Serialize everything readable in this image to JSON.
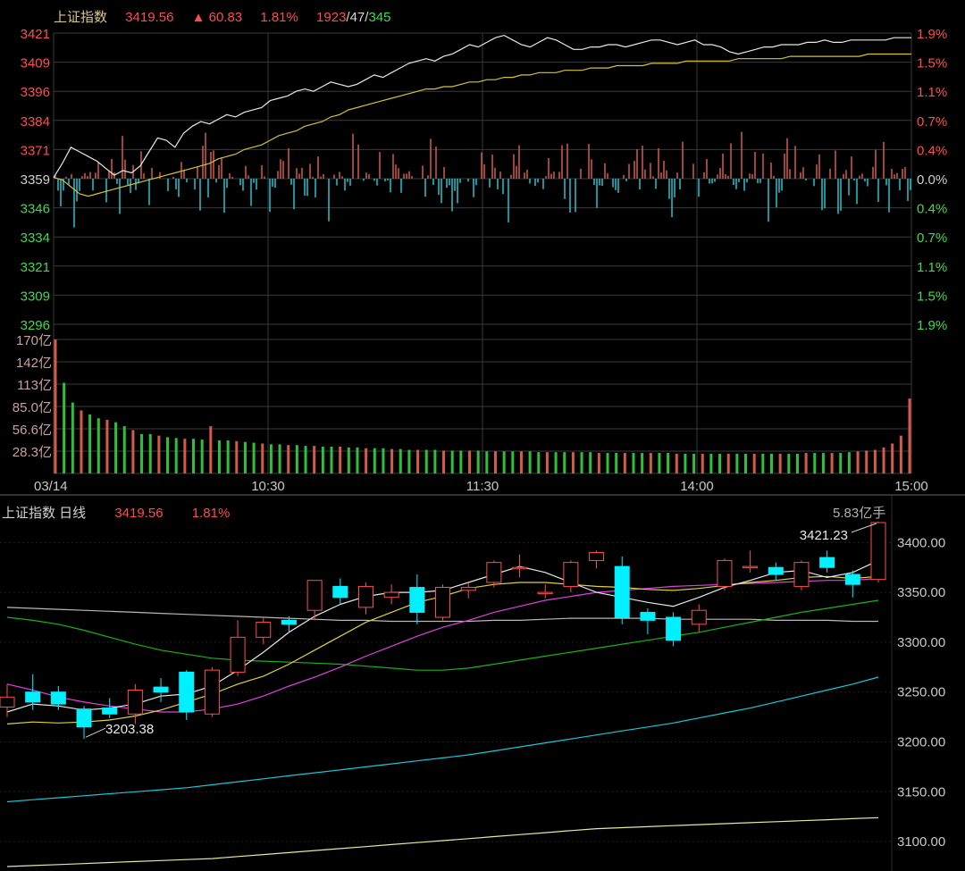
{
  "intraday": {
    "index_name": "上证指数",
    "price": "3419.56",
    "change": "▲ 60.83",
    "pct": "1.81%",
    "breadth_up": "1923",
    "breadth_flat": "47",
    "breadth_down": "345",
    "breadth_sep": "/"
  },
  "daily": {
    "title": "上证指数 日线",
    "price": "3419.56",
    "pct": "1.81%",
    "volume": "5.83亿手"
  },
  "colors": {
    "up": "#ff4d4d",
    "down": "#3ddc4a",
    "bar_down": "#25c4d0",
    "price_line": "#e8e8e8",
    "avg_line": "#d6c23a",
    "grid": "#3a3a3a",
    "candle_down_fill": "#00f0ff",
    "ma5": "#e8e8e8",
    "ma10": "#e0d23a",
    "ma20": "#e040e0",
    "ma30": "#19b219",
    "ma60": "#b8b8b8",
    "ma120": "#19c8d8",
    "ma250": "#e8e8a0"
  },
  "chart_data": [
    {
      "type": "line",
      "name": "intraday",
      "y_left_ticks": [
        "3421",
        "3409",
        "3396",
        "3384",
        "3371",
        "3359",
        "3346",
        "3334",
        "3321",
        "3309",
        "3296"
      ],
      "y_right_ticks": [
        "1.9%",
        "1.5%",
        "1.1%",
        "0.7%",
        "0.4%",
        "0.0%",
        "0.4%",
        "0.7%",
        "1.1%",
        "1.5%",
        "1.9%"
      ],
      "ylim": [
        3296,
        3421
      ],
      "prev_close": 3359,
      "price": [
        3359,
        3365,
        3372,
        3370,
        3368,
        3366,
        3363,
        3360,
        3362,
        3361,
        3364,
        3370,
        3376,
        3375,
        3372,
        3378,
        3381,
        3383,
        3382,
        3384,
        3386,
        3385,
        3387,
        3388,
        3389,
        3392,
        3393,
        3394,
        3396,
        3397,
        3396,
        3398,
        3400,
        3399,
        3398,
        3399,
        3401,
        3403,
        3402,
        3404,
        3406,
        3408,
        3409,
        3410,
        3409,
        3411,
        3412,
        3414,
        3416,
        3415,
        3417,
        3419,
        3420,
        3418,
        3416,
        3415,
        3417,
        3419,
        3418,
        3416,
        3414,
        3414,
        3415,
        3415,
        3416,
        3416,
        3415,
        3416,
        3417,
        3418,
        3418,
        3417,
        3416,
        3417,
        3418,
        3416,
        3416,
        3415,
        3413,
        3412,
        3413,
        3414,
        3415,
        3415,
        3416,
        3416,
        3416,
        3417,
        3417,
        3418,
        3417,
        3417,
        3418,
        3418,
        3418,
        3418,
        3418,
        3419,
        3419,
        3419
      ],
      "avg": [
        3359,
        3358,
        3355,
        3352,
        3351,
        3352,
        3353,
        3354,
        3355,
        3356,
        3357,
        3358,
        3359,
        3360,
        3361,
        3362,
        3363,
        3364,
        3365,
        3367,
        3368,
        3369,
        3371,
        3372,
        3373,
        3375,
        3377,
        3378,
        3379,
        3381,
        3382,
        3383,
        3385,
        3386,
        3388,
        3389,
        3390,
        3391,
        3392,
        3393,
        3394,
        3395,
        3396,
        3397,
        3397,
        3398,
        3398,
        3399,
        3400,
        3400,
        3401,
        3401,
        3402,
        3402,
        3403,
        3403,
        3404,
        3404,
        3404,
        3405,
        3405,
        3405,
        3406,
        3406,
        3406,
        3407,
        3407,
        3407,
        3407,
        3408,
        3408,
        3408,
        3408,
        3409,
        3409,
        3409,
        3409,
        3409,
        3409,
        3410,
        3410,
        3410,
        3410,
        3410,
        3410,
        3411,
        3411,
        3411,
        3411,
        3411,
        3411,
        3411,
        3411,
        3411,
        3412,
        3412,
        3412,
        3412,
        3412,
        3412
      ],
      "x_ticks": [
        "03/14",
        "10:30",
        "11:30",
        "14:00",
        "15:00"
      ]
    },
    {
      "type": "bar",
      "name": "intraday-volume",
      "y_ticks": [
        "170亿",
        "142亿",
        "113亿",
        "85.0亿",
        "56.6亿",
        "28.3亿"
      ],
      "ylim": [
        0,
        170
      ],
      "values": [
        170,
        115,
        90,
        80,
        75,
        70,
        68,
        65,
        60,
        55,
        50,
        50,
        48,
        46,
        45,
        44,
        44,
        43,
        60,
        42,
        42,
        41,
        40,
        39,
        38,
        37,
        37,
        36,
        36,
        35,
        35,
        34,
        34,
        34,
        33,
        33,
        32,
        32,
        32,
        31,
        31,
        30,
        30,
        30,
        30,
        29,
        29,
        29,
        29,
        29,
        28,
        28,
        28,
        28,
        28,
        28,
        27,
        27,
        27,
        27,
        27,
        27,
        27,
        26,
        26,
        26,
        26,
        26,
        26,
        26,
        26,
        26,
        25,
        25,
        25,
        25,
        25,
        25,
        25,
        25,
        25,
        25,
        25,
        25,
        25,
        25,
        25,
        26,
        26,
        26,
        26,
        26,
        27,
        28,
        29,
        30,
        33,
        38,
        48,
        95
      ]
    },
    {
      "type": "line",
      "name": "daily-candles",
      "y_ticks": [
        "3400.00",
        "3350.00",
        "3300.00",
        "3250.00",
        "3200.00",
        "3150.00",
        "3100.00"
      ],
      "ylim": [
        3075,
        3420
      ],
      "annotations": [
        "3421.23",
        "3203.38"
      ],
      "candles": [
        {
          "o": 3235,
          "c": 3245,
          "h": 3258,
          "l": 3225
        },
        {
          "o": 3250,
          "c": 3240,
          "h": 3268,
          "l": 3232
        },
        {
          "o": 3250,
          "c": 3238,
          "h": 3256,
          "l": 3232
        },
        {
          "o": 3233,
          "c": 3215,
          "h": 3236,
          "l": 3203
        },
        {
          "o": 3234,
          "c": 3228,
          "h": 3244,
          "l": 3224
        },
        {
          "o": 3228,
          "c": 3252,
          "h": 3258,
          "l": 3218
        },
        {
          "o": 3255,
          "c": 3250,
          "h": 3264,
          "l": 3240
        },
        {
          "o": 3270,
          "c": 3230,
          "h": 3272,
          "l": 3222
        },
        {
          "o": 3228,
          "c": 3272,
          "h": 3275,
          "l": 3225
        },
        {
          "o": 3270,
          "c": 3305,
          "h": 3322,
          "l": 3266
        },
        {
          "o": 3305,
          "c": 3320,
          "h": 3324,
          "l": 3298
        },
        {
          "o": 3322,
          "c": 3318,
          "h": 3326,
          "l": 3310
        },
        {
          "o": 3332,
          "c": 3362,
          "h": 3362,
          "l": 3322
        },
        {
          "o": 3356,
          "c": 3345,
          "h": 3364,
          "l": 3338
        },
        {
          "o": 3335,
          "c": 3356,
          "h": 3360,
          "l": 3328
        },
        {
          "o": 3345,
          "c": 3350,
          "h": 3358,
          "l": 3338
        },
        {
          "o": 3355,
          "c": 3330,
          "h": 3368,
          "l": 3318
        },
        {
          "o": 3325,
          "c": 3355,
          "h": 3358,
          "l": 3322
        },
        {
          "o": 3352,
          "c": 3355,
          "h": 3360,
          "l": 3344
        },
        {
          "o": 3360,
          "c": 3380,
          "h": 3382,
          "l": 3355
        },
        {
          "o": 3375,
          "c": 3375,
          "h": 3388,
          "l": 3365
        },
        {
          "o": 3350,
          "c": 3350,
          "h": 3358,
          "l": 3344
        },
        {
          "o": 3356,
          "c": 3380,
          "h": 3382,
          "l": 3350
        },
        {
          "o": 3382,
          "c": 3390,
          "h": 3392,
          "l": 3374
        },
        {
          "o": 3376,
          "c": 3325,
          "h": 3386,
          "l": 3318
        },
        {
          "o": 3330,
          "c": 3322,
          "h": 3334,
          "l": 3308
        },
        {
          "o": 3325,
          "c": 3302,
          "h": 3330,
          "l": 3296
        },
        {
          "o": 3318,
          "c": 3332,
          "h": 3338,
          "l": 3310
        },
        {
          "o": 3356,
          "c": 3382,
          "h": 3384,
          "l": 3352
        },
        {
          "o": 3376,
          "c": 3376,
          "h": 3392,
          "l": 3370
        },
        {
          "o": 3375,
          "c": 3368,
          "h": 3380,
          "l": 3362
        },
        {
          "o": 3356,
          "c": 3380,
          "h": 3382,
          "l": 3352
        },
        {
          "o": 3385,
          "c": 3375,
          "h": 3392,
          "l": 3370
        },
        {
          "o": 3368,
          "c": 3358,
          "h": 3372,
          "l": 3345
        },
        {
          "o": 3363,
          "c": 3420,
          "h": 3421,
          "l": 3360
        }
      ],
      "ma5": [
        3230,
        3238,
        3236,
        3232,
        3234,
        3238,
        3246,
        3248,
        3256,
        3272,
        3290,
        3310,
        3326,
        3338,
        3346,
        3350,
        3350,
        3352,
        3360,
        3368,
        3376,
        3370,
        3360,
        3350,
        3345,
        3340,
        3336,
        3345,
        3355,
        3362,
        3370,
        3372,
        3365,
        3370,
        3382
      ],
      "ma10": [
        3218,
        3220,
        3219,
        3220,
        3222,
        3226,
        3232,
        3240,
        3248,
        3258,
        3266,
        3278,
        3292,
        3306,
        3320,
        3330,
        3340,
        3346,
        3354,
        3358,
        3360,
        3360,
        3358,
        3356,
        3355,
        3353,
        3352,
        3354,
        3357,
        3360,
        3362,
        3365,
        3366,
        3364,
        3366
      ],
      "ma20": [
        3258,
        3252,
        3245,
        3240,
        3236,
        3233,
        3230,
        3230,
        3233,
        3238,
        3246,
        3256,
        3265,
        3275,
        3286,
        3296,
        3306,
        3315,
        3322,
        3330,
        3336,
        3342,
        3346,
        3350,
        3352,
        3354,
        3356,
        3357,
        3358,
        3359,
        3360,
        3361,
        3362,
        3362,
        3364
      ],
      "ma30": [
        3325,
        3322,
        3318,
        3312,
        3305,
        3298,
        3292,
        3288,
        3284,
        3282,
        3281,
        3280,
        3279,
        3278,
        3276,
        3274,
        3272,
        3272,
        3274,
        3278,
        3282,
        3286,
        3290,
        3294,
        3298,
        3302,
        3306,
        3310,
        3315,
        3320,
        3325,
        3330,
        3334,
        3338,
        3342
      ],
      "ma60": [
        3335,
        3334,
        3333,
        3332,
        3331,
        3330,
        3329,
        3328,
        3327,
        3326,
        3325,
        3324,
        3323,
        3322,
        3322,
        3321,
        3321,
        3321,
        3321,
        3322,
        3322,
        3323,
        3324,
        3324,
        3324,
        3324,
        3323,
        3323,
        3323,
        3323,
        3322,
        3322,
        3322,
        3321,
        3321
      ],
      "ma120": [
        3140,
        3142,
        3144,
        3146,
        3148,
        3150,
        3152,
        3154,
        3157,
        3160,
        3163,
        3166,
        3169,
        3172,
        3175,
        3178,
        3181,
        3184,
        3187,
        3191,
        3195,
        3199,
        3203,
        3207,
        3211,
        3215,
        3219,
        3224,
        3229,
        3234,
        3240,
        3246,
        3252,
        3258,
        3265
      ],
      "ma250": [
        3075,
        3076,
        3077,
        3078,
        3079,
        3080,
        3081,
        3082,
        3083,
        3085,
        3087,
        3089,
        3091,
        3093,
        3095,
        3097,
        3099,
        3101,
        3103,
        3105,
        3107,
        3109,
        3111,
        3113,
        3114,
        3115,
        3116,
        3117,
        3118,
        3119,
        3120,
        3121,
        3122,
        3123,
        3124
      ]
    }
  ]
}
